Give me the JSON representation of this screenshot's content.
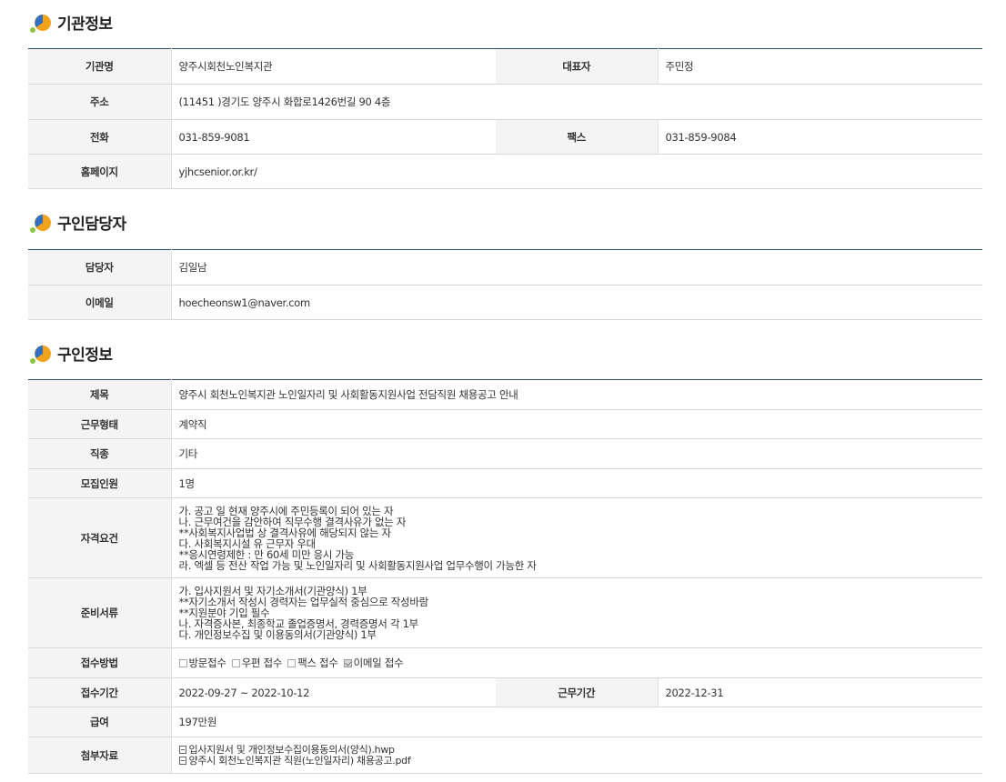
{
  "sections": {
    "org": {
      "title": "기관정보"
    },
    "contact": {
      "title": "구인담당자"
    },
    "job": {
      "title": "구인정보"
    }
  },
  "org": {
    "name_label": "기관명",
    "name": "양주시회천노인복지관",
    "ceo_label": "대표자",
    "ceo": "주민정",
    "address_label": "주소",
    "address": "(11451 )경기도 양주시 화합로1426번길 90 4층",
    "phone_label": "전화",
    "phone": "031-859-9081",
    "fax_label": "팩스",
    "fax": "031-859-9084",
    "homepage_label": "홈페이지",
    "homepage": "yjhcsenior.or.kr/"
  },
  "contact": {
    "manager_label": "담당자",
    "manager": "김일남",
    "email_label": "이메일",
    "email": "hoecheonsw1@naver.com"
  },
  "job": {
    "title_label": "제목",
    "title": "양주시 회천노인복지관 노인일자리 및 사회활동지원사업 전담직원 채용공고 안내",
    "type_label": "근무형태",
    "type": "계약직",
    "category_label": "직종",
    "category": "기타",
    "headcount_label": "모집인원",
    "headcount": "1명",
    "requirements_label": "자격요건",
    "requirements": [
      "가. 공고 일 현재 양주시에 주민등록이 되어 있는 자",
      "나. 근무여건을 감안하여 직무수행 결격사유가 없는 자",
      "**사회복지사업법 상 결격사유에 해당되지 않는 자",
      "다. 사회복지시설 유 근무자 우대",
      "**응시연령제한 : 만 60세 미만 응시 가능",
      "라. 엑셀 등 전산 작업 가능 및 노인일자리 및 사회활동지원사업 업무수행이 가능한 자"
    ],
    "documents_label": "준비서류",
    "documents": [
      "가. 입사지원서 및 자기소개서(기관양식) 1부",
      "**자기소개서 작성시 경력자는 업무실적 중심으로 작성바람",
      "**지원분야 기입 필수",
      "나. 자격증사본, 최종학교 졸업증명서, 경력증명서 각 1부",
      "다. 개인정보수집 및 이용동의서(기관양식) 1부"
    ],
    "method_label": "접수방법",
    "methods": [
      {
        "label": "방문접수",
        "checked": false
      },
      {
        "label": "우편 접수",
        "checked": false
      },
      {
        "label": "팩스 접수",
        "checked": false
      },
      {
        "label": "이메일 접수",
        "checked": true
      }
    ],
    "period_label": "접수기간",
    "period": "2022-09-27 ~ 2022-10-12",
    "work_period_label": "근무기간",
    "work_period": "2022-12-31",
    "salary_label": "급여",
    "salary": "197만원",
    "attachments_label": "첨부자료",
    "attachments": [
      "입사지원서 및 개인정보수집이용동의서(양식).hwp",
      "양주시 회천노인복지관 직원(노인일자리) 채용공고.pdf"
    ]
  },
  "colors": {
    "header_line": "#2b4a6b",
    "label_bg": "#f4f4f4",
    "logo_orange": "#f5a21b",
    "logo_blue": "#2f6fc4",
    "logo_green": "#8cc63e"
  }
}
